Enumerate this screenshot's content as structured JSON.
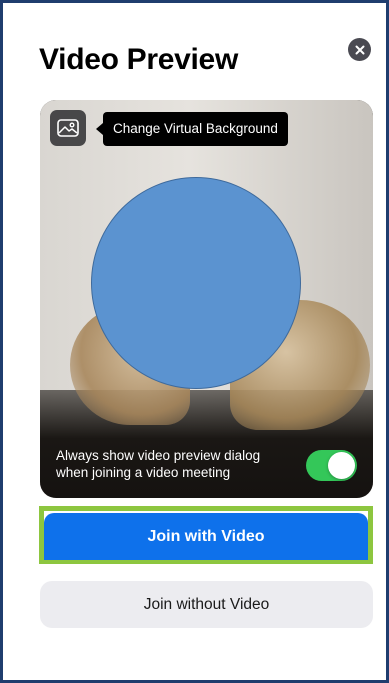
{
  "dialog": {
    "title": "Video Preview",
    "close_icon": "close-icon"
  },
  "preview": {
    "virtual_background_icon": "image-icon",
    "virtual_background_tooltip": "Change Virtual Background",
    "always_show_label_line1": "Always show video preview dialog",
    "always_show_label_line2": "when joining a video meeting",
    "always_show_enabled": true
  },
  "actions": {
    "join_with_video_label": "Join with Video",
    "join_without_video_label": "Join without Video"
  },
  "colors": {
    "primary_blue": "#0e71eb",
    "toggle_on": "#34c759",
    "highlight_green": "#8dc63f",
    "face_mask": "#5b93d0",
    "border_navy": "#1f3d6e"
  }
}
